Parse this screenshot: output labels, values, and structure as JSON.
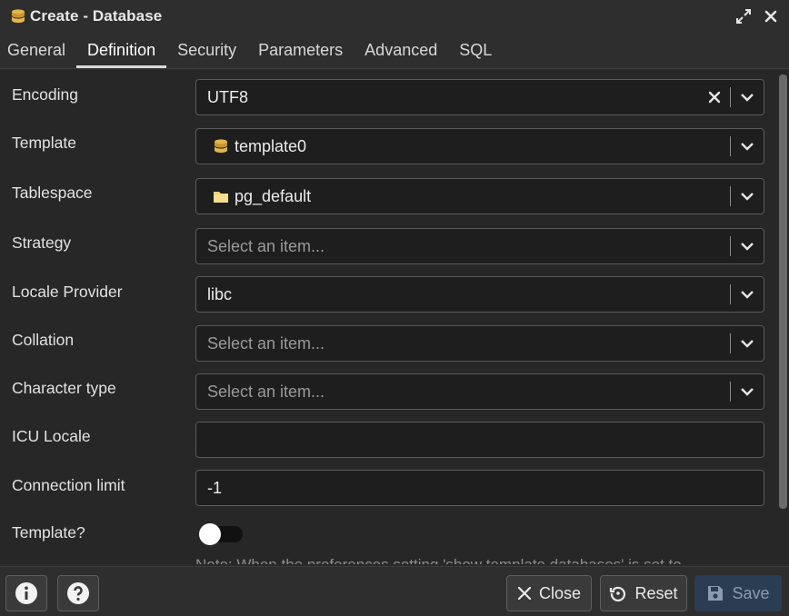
{
  "window": {
    "title": "Create - Database",
    "icons": [
      "database-icon",
      "expand-icon",
      "close-icon"
    ]
  },
  "tabs": [
    {
      "label": "General",
      "active": false
    },
    {
      "label": "Definition",
      "active": true
    },
    {
      "label": "Security",
      "active": false
    },
    {
      "label": "Parameters",
      "active": false
    },
    {
      "label": "Advanced",
      "active": false
    },
    {
      "label": "SQL",
      "active": false
    }
  ],
  "form": {
    "encoding": {
      "label": "Encoding",
      "value": "UTF8",
      "clearable": true
    },
    "template": {
      "label": "Template",
      "value": "template0",
      "icon": "database-icon"
    },
    "tablespace": {
      "label": "Tablespace",
      "value": "pg_default",
      "icon": "folder-icon"
    },
    "strategy": {
      "label": "Strategy",
      "placeholder": "Select an item..."
    },
    "locale_provider": {
      "label": "Locale Provider",
      "value": "libc"
    },
    "collation": {
      "label": "Collation",
      "placeholder": "Select an item..."
    },
    "character_type": {
      "label": "Character type",
      "placeholder": "Select an item..."
    },
    "icu_locale": {
      "label": "ICU Locale",
      "value": ""
    },
    "connection_limit": {
      "label": "Connection limit",
      "value": "-1"
    },
    "is_template": {
      "label": "Template?",
      "checked": false
    },
    "note": "Note: When the preferences setting 'show template databases' is set to"
  },
  "footer": {
    "info_icon": "info-icon",
    "help_icon": "help-icon",
    "close_label": "Close",
    "reset_label": "Reset",
    "save_label": "Save"
  },
  "colors": {
    "background": "#272727",
    "field_bg": "#1e1e1e",
    "save_button_bg": "#2a3d52",
    "tab_active_indicator": "#d9d9d9"
  }
}
